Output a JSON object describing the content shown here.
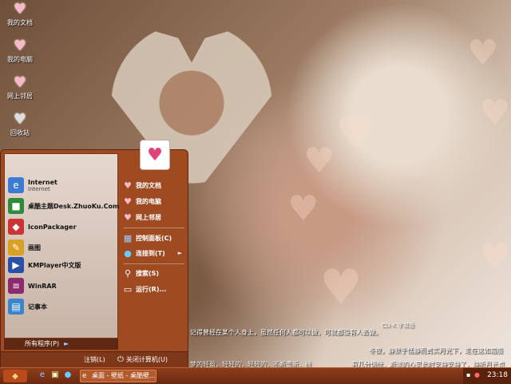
{
  "desktop": {
    "icons": [
      {
        "label": "我的文档",
        "icon": "heart-icon"
      },
      {
        "label": "我的电脑",
        "icon": "heart-icon"
      },
      {
        "label": "网上邻居",
        "icon": "heart-icon"
      },
      {
        "label": "回收站",
        "icon": "heart-icon"
      }
    ],
    "wallpaper_text": {
      "line1": "记得曾经在某个人身上，虽然任何人都可以做，可就都没有人去做。",
      "line2": "冬夜，静默于恬静而真实月光下，走在这如霜般",
      "line3": "有几分惆怅、断淡的心灵此时安静安静了，静听月光点",
      "line4": "梦的轻盈，轻轻的，轻轻的，不断重新。椅",
      "line5": "CLI-K 字幕版"
    }
  },
  "start_menu": {
    "programs": [
      {
        "title": "Internet",
        "subtitle": "Internet",
        "icon": "globe-icon",
        "color": "#3b7bd6"
      },
      {
        "title": "桌酷主题Desk.ZhuoKu.Com",
        "subtitle": "",
        "icon": "theme-icon",
        "color": "#2f8a3a"
      },
      {
        "title": "IconPackager",
        "subtitle": "",
        "icon": "package-icon",
        "color": "#c33"
      },
      {
        "title": "画图",
        "subtitle": "",
        "icon": "paint-icon",
        "color": "#d9a021"
      },
      {
        "title": "KMPlayer中文版",
        "subtitle": "",
        "icon": "player-icon",
        "color": "#2a4fa8"
      },
      {
        "title": "WinRAR",
        "subtitle": "",
        "icon": "archive-icon",
        "color": "#8b2a6e"
      },
      {
        "title": "记事本",
        "subtitle": "",
        "icon": "notepad-icon",
        "color": "#3a86c9"
      }
    ],
    "all_programs": "所有程序(P)",
    "right_items": [
      {
        "label": "我的文档",
        "icon": "heart-icon"
      },
      {
        "label": "我的电脑",
        "icon": "heart-icon"
      },
      {
        "label": "网上邻居",
        "icon": "heart-icon"
      },
      {
        "label": "控制面板(C)",
        "icon": "control-panel-icon"
      },
      {
        "label": "连接到(T)",
        "icon": "connect-icon"
      },
      {
        "label": "搜索(S)",
        "icon": "search-icon"
      },
      {
        "label": "运行(R)...",
        "icon": "run-icon"
      }
    ],
    "logoff": "注销(L)",
    "shutdown": "关闭计算机(U)"
  },
  "taskbar": {
    "task_label": "桌面 - 壁纸 - 桌酷壁...",
    "clock": "23:18"
  },
  "colors": {
    "menu_bg": "#a04a22",
    "taskbar_bg": "#7a3314",
    "heart": "#f7b8c8"
  }
}
